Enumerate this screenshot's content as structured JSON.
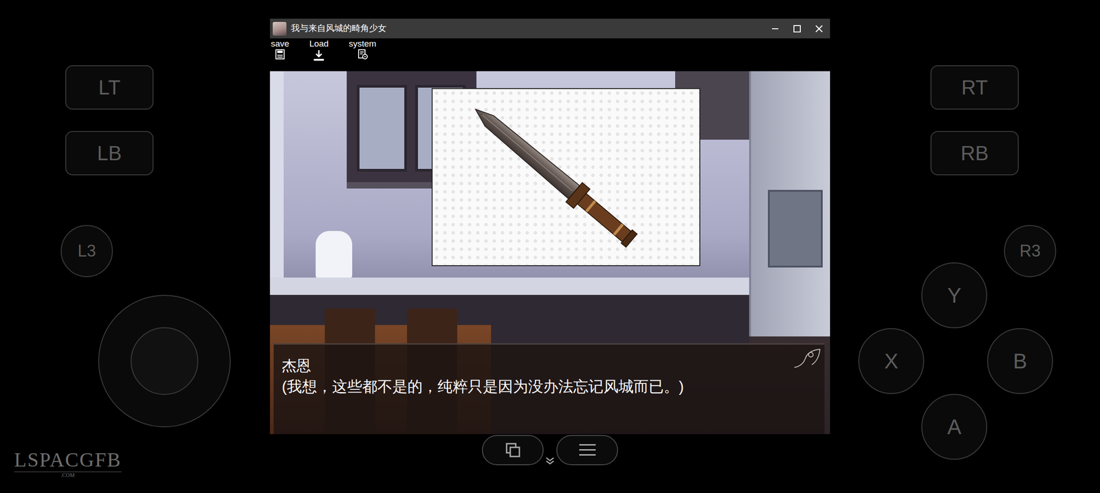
{
  "window": {
    "title": "我与来自风城的畸角少女"
  },
  "menu": [
    {
      "label": "save"
    },
    {
      "label": "Load"
    },
    {
      "label": "system"
    }
  ],
  "dialogue": {
    "speaker": "杰恩",
    "text": "(我想，这些都不是的，纯粹只是因为没办法忘记风城而已。)"
  },
  "gamepad": {
    "left": [
      "LT",
      "LB",
      "L3"
    ],
    "right": [
      "RT",
      "RB",
      "R3"
    ],
    "face": [
      "Y",
      "X",
      "B",
      "A"
    ]
  },
  "watermark": {
    "text": "LSPACGFB",
    "sub": ".COM"
  }
}
